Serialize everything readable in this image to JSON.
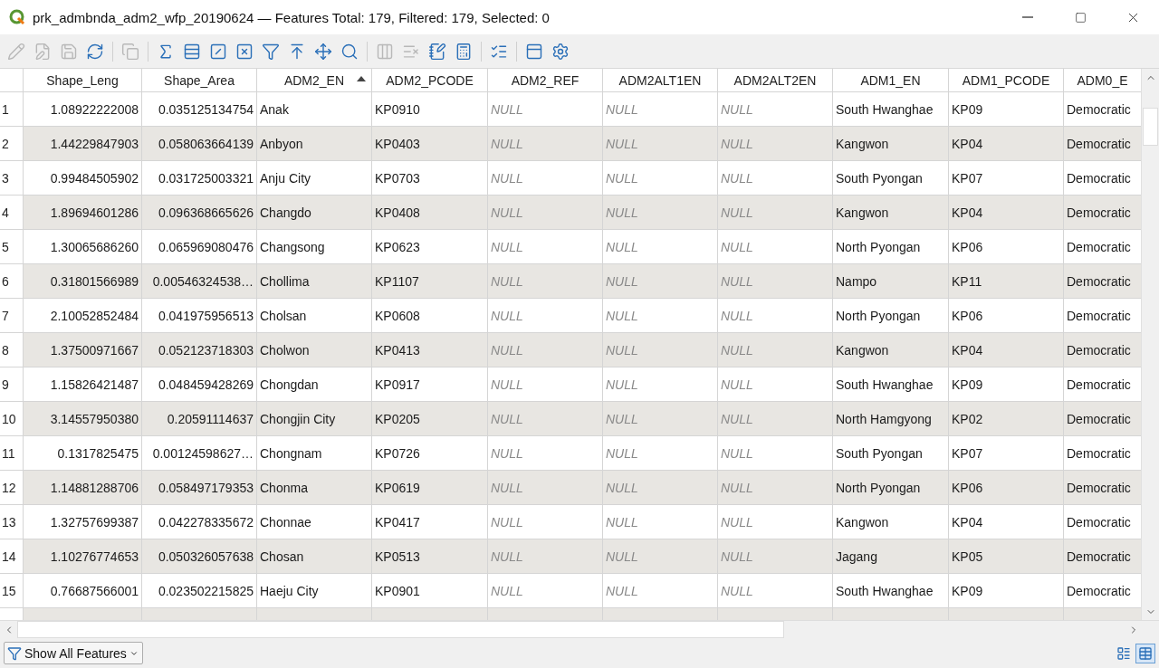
{
  "window": {
    "title": "prk_admbnda_adm2_wfp_20190624 — Features Total: 179, Filtered: 179, Selected: 0"
  },
  "toolbar": [
    {
      "kind": "pencil",
      "disabled": true
    },
    {
      "kind": "edit",
      "disabled": true
    },
    {
      "kind": "save",
      "disabled": true
    },
    {
      "kind": "refresh",
      "disabled": false
    },
    {
      "kind": "separator"
    },
    {
      "kind": "copy",
      "disabled": true
    },
    {
      "kind": "separator"
    },
    {
      "kind": "expression",
      "disabled": false
    },
    {
      "kind": "select-all",
      "disabled": false
    },
    {
      "kind": "invert",
      "disabled": false
    },
    {
      "kind": "deselect",
      "disabled": false
    },
    {
      "kind": "filter",
      "disabled": false
    },
    {
      "kind": "move-top",
      "disabled": false
    },
    {
      "kind": "pan",
      "disabled": false
    },
    {
      "kind": "zoom",
      "disabled": false
    },
    {
      "kind": "separator"
    },
    {
      "kind": "new-field",
      "disabled": true
    },
    {
      "kind": "delete-field",
      "disabled": true
    },
    {
      "kind": "field-edit",
      "disabled": false
    },
    {
      "kind": "calculator",
      "disabled": false
    },
    {
      "kind": "separator"
    },
    {
      "kind": "conditional",
      "disabled": false
    },
    {
      "kind": "separator"
    },
    {
      "kind": "dock",
      "disabled": false
    },
    {
      "kind": "actions",
      "disabled": false
    }
  ],
  "table": {
    "columns": [
      {
        "label": "Shape_Leng",
        "kind": "number",
        "sorted": false
      },
      {
        "label": "Shape_Area",
        "kind": "number",
        "sorted": false
      },
      {
        "label": "ADM2_EN",
        "kind": "text",
        "sorted": true
      },
      {
        "label": "ADM2_PCODE",
        "kind": "text",
        "sorted": false
      },
      {
        "label": "ADM2_REF",
        "kind": "text",
        "sorted": false
      },
      {
        "label": "ADM2ALT1EN",
        "kind": "text",
        "sorted": false
      },
      {
        "label": "ADM2ALT2EN",
        "kind": "text",
        "sorted": false
      },
      {
        "label": "ADM1_EN",
        "kind": "text",
        "sorted": false
      },
      {
        "label": "ADM1_PCODE",
        "kind": "text",
        "sorted": false
      },
      {
        "label": "ADM0_E",
        "kind": "text",
        "sorted": false
      }
    ],
    "rows": [
      {
        "number": "1",
        "cells": [
          "1.08922222008",
          "0.035125134754",
          "Anak",
          "KP0910",
          {
            "text": "NULL",
            "null": true
          },
          {
            "text": "NULL",
            "null": true
          },
          {
            "text": "NULL",
            "null": true
          },
          "South Hwanghae",
          "KP09",
          "Democratic"
        ]
      },
      {
        "number": "2",
        "cells": [
          "1.44229847903",
          "0.058063664139",
          "Anbyon",
          "KP0403",
          {
            "text": "NULL",
            "null": true
          },
          {
            "text": "NULL",
            "null": true
          },
          {
            "text": "NULL",
            "null": true
          },
          "Kangwon",
          "KP04",
          "Democratic"
        ]
      },
      {
        "number": "3",
        "cells": [
          "0.99484505902",
          "0.031725003321",
          "Anju City",
          "KP0703",
          {
            "text": "NULL",
            "null": true
          },
          {
            "text": "NULL",
            "null": true
          },
          {
            "text": "NULL",
            "null": true
          },
          "South Pyongan",
          "KP07",
          "Democratic"
        ]
      },
      {
        "number": "4",
        "cells": [
          "1.89694601286",
          "0.096368665626",
          "Changdo",
          "KP0408",
          {
            "text": "NULL",
            "null": true
          },
          {
            "text": "NULL",
            "null": true
          },
          {
            "text": "NULL",
            "null": true
          },
          "Kangwon",
          "KP04",
          "Democratic"
        ]
      },
      {
        "number": "5",
        "cells": [
          "1.30065686260",
          "0.065969080476",
          "Changsong",
          "KP0623",
          {
            "text": "NULL",
            "null": true
          },
          {
            "text": "NULL",
            "null": true
          },
          {
            "text": "NULL",
            "null": true
          },
          "North Pyongan",
          "KP06",
          "Democratic"
        ]
      },
      {
        "number": "6",
        "cells": [
          "0.31801566989",
          "0.00546324538…",
          "Chollima",
          "KP1107",
          {
            "text": "NULL",
            "null": true
          },
          {
            "text": "NULL",
            "null": true
          },
          {
            "text": "NULL",
            "null": true
          },
          "Nampo",
          "KP11",
          "Democratic"
        ]
      },
      {
        "number": "7",
        "cells": [
          "2.10052852484",
          "0.041975956513",
          "Cholsan",
          "KP0608",
          {
            "text": "NULL",
            "null": true
          },
          {
            "text": "NULL",
            "null": true
          },
          {
            "text": "NULL",
            "null": true
          },
          "North Pyongan",
          "KP06",
          "Democratic"
        ]
      },
      {
        "number": "8",
        "cells": [
          "1.37500971667",
          "0.052123718303",
          "Cholwon",
          "KP0413",
          {
            "text": "NULL",
            "null": true
          },
          {
            "text": "NULL",
            "null": true
          },
          {
            "text": "NULL",
            "null": true
          },
          "Kangwon",
          "KP04",
          "Democratic"
        ]
      },
      {
        "number": "9",
        "cells": [
          "1.15826421487",
          "0.048459428269",
          "Chongdan",
          "KP0917",
          {
            "text": "NULL",
            "null": true
          },
          {
            "text": "NULL",
            "null": true
          },
          {
            "text": "NULL",
            "null": true
          },
          "South Hwanghae",
          "KP09",
          "Democratic"
        ]
      },
      {
        "number": "10",
        "cells": [
          "3.14557950380",
          "0.20591114637",
          "Chongjin City",
          "KP0205",
          {
            "text": "NULL",
            "null": true
          },
          {
            "text": "NULL",
            "null": true
          },
          {
            "text": "NULL",
            "null": true
          },
          "North Hamgyong",
          "KP02",
          "Democratic"
        ]
      },
      {
        "number": "11",
        "cells": [
          "0.1317825475",
          "0.00124598627…",
          "Chongnam",
          "KP0726",
          {
            "text": "NULL",
            "null": true
          },
          {
            "text": "NULL",
            "null": true
          },
          {
            "text": "NULL",
            "null": true
          },
          "South Pyongan",
          "KP07",
          "Democratic"
        ]
      },
      {
        "number": "12",
        "cells": [
          "1.14881288706",
          "0.058497179353",
          "Chonma",
          "KP0619",
          {
            "text": "NULL",
            "null": true
          },
          {
            "text": "NULL",
            "null": true
          },
          {
            "text": "NULL",
            "null": true
          },
          "North Pyongan",
          "KP06",
          "Democratic"
        ]
      },
      {
        "number": "13",
        "cells": [
          "1.32757699387",
          "0.042278335672",
          "Chonnae",
          "KP0417",
          {
            "text": "NULL",
            "null": true
          },
          {
            "text": "NULL",
            "null": true
          },
          {
            "text": "NULL",
            "null": true
          },
          "Kangwon",
          "KP04",
          "Democratic"
        ]
      },
      {
        "number": "14",
        "cells": [
          "1.10276774653",
          "0.050326057638",
          "Chosan",
          "KP0513",
          {
            "text": "NULL",
            "null": true
          },
          {
            "text": "NULL",
            "null": true
          },
          {
            "text": "NULL",
            "null": true
          },
          "Jagang",
          "KP05",
          "Democratic"
        ]
      },
      {
        "number": "15",
        "cells": [
          "0.76687566001",
          "0.023502215825",
          "Haeju City",
          "KP0901",
          {
            "text": "NULL",
            "null": true
          },
          {
            "text": "NULL",
            "null": true
          },
          {
            "text": "NULL",
            "null": true
          },
          "South Hwanghae",
          "KP09",
          "Democratic"
        ]
      }
    ]
  },
  "footer": {
    "filter_button": "Show All Features",
    "views": [
      {
        "kind": "form",
        "selected": false
      },
      {
        "kind": "table",
        "selected": true
      }
    ]
  }
}
